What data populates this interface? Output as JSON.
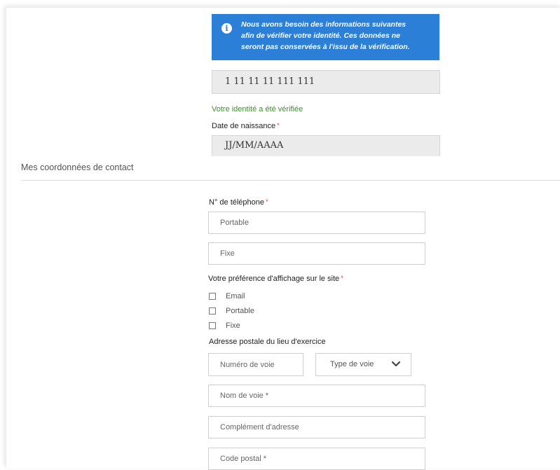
{
  "info_box": {
    "lines": [
      "Nous avons besoin des informations suivantes",
      "afin de vérifier votre identité. Ces données ne",
      "seront pas conservées à l'issu de la vérification."
    ],
    "icon_glyph": "i"
  },
  "identity": {
    "social_security_value": "1 11 11 11 111 111",
    "verified_message": "Votre identité a été vérifiée"
  },
  "birth_date": {
    "label": "Date de naissance",
    "value": "JJ/MM/AAAA"
  },
  "required_mark": "*",
  "contact_section": {
    "title": "Mes coordonnées de contact"
  },
  "phone": {
    "label": "N° de téléphone",
    "mobile_placeholder": "Portable",
    "landline_placeholder": "Fixe"
  },
  "display_preference": {
    "label": "Votre préférence d'affichage sur le site",
    "options": [
      "Email",
      "Portable",
      "Fixe"
    ]
  },
  "address": {
    "label": "Adresse postale du lieu d'exercice",
    "street_number_placeholder": "Numéro de voie",
    "street_type_selected": "Type de voie",
    "street_name_placeholder": "Nom de voie *",
    "address_complement_placeholder": "Complément d'adresse",
    "postal_code_placeholder": "Code postal *"
  },
  "colors": {
    "info_blue": "#2c7fd6",
    "success_green": "#3e8e2f",
    "required_red": "#e53935"
  }
}
